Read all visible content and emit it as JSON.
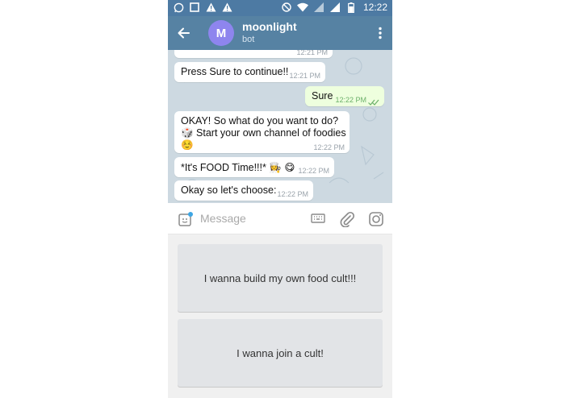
{
  "status_bar": {
    "time": "12:22",
    "left_icons": [
      "whatsapp-icon",
      "square-icon",
      "warning-icon",
      "warning-icon"
    ],
    "right_icons": [
      "do-not-disturb-icon",
      "wifi-icon",
      "signal-icon",
      "signal-icon",
      "battery-icon"
    ]
  },
  "header": {
    "avatar_letter": "M",
    "avatar_color": "#8e85ee",
    "title": "moonlight",
    "subtitle": "bot",
    "header_color": "#5682a3"
  },
  "messages": [
    {
      "text": "",
      "time": "12:21 PM",
      "direction": "in"
    },
    {
      "text": "Press Sure to continue!!",
      "time": "12:21 PM",
      "direction": "in"
    },
    {
      "text": "Sure",
      "time": "12:22 PM",
      "direction": "out",
      "status": "read"
    },
    {
      "text_line1": "OKAY! So what do you want to do?",
      "text_line2": "🎲 Start your own channel of foodies",
      "text_line3": "☺️",
      "time": "12:22 PM",
      "direction": "in"
    },
    {
      "text": "*It's FOOD Time!!!* 👩‍🍳 😋",
      "time": "12:22 PM",
      "direction": "in"
    },
    {
      "text": "Okay so let's choose:",
      "time": "12:22 PM",
      "direction": "in"
    }
  ],
  "input": {
    "placeholder": "Message"
  },
  "keyboard": {
    "buttons": [
      {
        "label": "I wanna build my own food cult!!!"
      },
      {
        "label": "I wanna join a cult!"
      }
    ]
  }
}
